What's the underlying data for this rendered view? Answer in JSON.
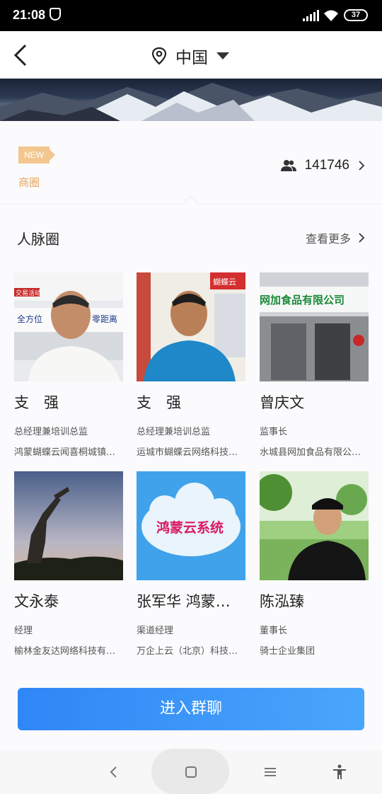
{
  "status_bar": {
    "time": "21:08",
    "battery": "37"
  },
  "header": {
    "location": "中国"
  },
  "business": {
    "new_tag": "NEW",
    "label": "商圈",
    "member_count": "141746"
  },
  "section": {
    "title": "人脉圈",
    "more_label": "查看更多"
  },
  "people": [
    {
      "name": "支　强",
      "role": "总经理兼培训总监",
      "company": "鸿蒙蝴蝶云闻喜桐城镇…"
    },
    {
      "name": "支　强",
      "role": "总经理兼培训总监",
      "company": "运城市蝴蝶云网络科技…"
    },
    {
      "name": "曾庆文",
      "role": "监事长",
      "company": "水城县网加食品有限公…"
    },
    {
      "name": "文永泰",
      "role": "经理",
      "company": "榆林金友达网络科技有…"
    },
    {
      "name": "张军华  鸿蒙…",
      "role": "渠道经理",
      "company": "万企上云（北京）科技…"
    },
    {
      "name": "陈泓臻",
      "role": "董事长",
      "company": "骑士企业集团"
    }
  ],
  "photo_texts": {
    "p1_left": "全方位",
    "p1_right": "零距离",
    "p1_top": "交易活动",
    "p2_sign": "蝴蝶云",
    "p3_sign": "网加食品有限公司",
    "p5_cloud": "鸿蒙云系统"
  },
  "join_button": "进入群聊",
  "colors": {
    "accent": "#2f86f6",
    "new_tag": "#f3c690",
    "biz_label": "#e8a55a"
  },
  "icons": [
    "back-icon",
    "location-pin-icon",
    "caret-down-icon",
    "people-icon",
    "chevron-right-icon",
    "nav-back-icon",
    "nav-home-icon",
    "nav-menu-icon",
    "accessibility-icon"
  ]
}
